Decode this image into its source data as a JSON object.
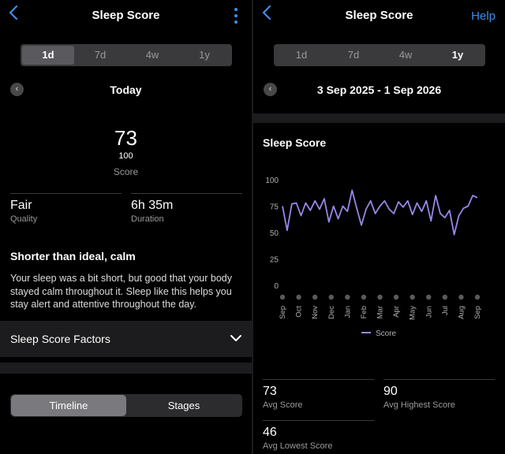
{
  "left": {
    "header": {
      "title": "Sleep Score"
    },
    "ranges": [
      "1d",
      "7d",
      "4w",
      "1y"
    ],
    "active_range": "1d",
    "date_label": "Today",
    "score": {
      "value": "73",
      "max": "100",
      "label": "Score"
    },
    "quality": {
      "value": "Fair",
      "label": "Quality"
    },
    "duration": {
      "value": "6h 35m",
      "label": "Duration"
    },
    "headline": "Shorter than ideal, calm",
    "body": "Your sleep was a bit short, but good that your body stayed calm throughout it. Sleep like this helps you stay alert and attentive throughout the day.",
    "factors_label": "Sleep Score Factors",
    "tabs": [
      "Timeline",
      "Stages"
    ],
    "active_tab": "Timeline"
  },
  "right": {
    "header": {
      "title": "Sleep Score",
      "help": "Help"
    },
    "ranges": [
      "1d",
      "7d",
      "4w",
      "1y"
    ],
    "active_range": "1y",
    "date_label": "3 Sep 2025 - 1 Sep 2026",
    "chart_title": "Sleep Score",
    "stats": {
      "avg": {
        "value": "73",
        "label": "Avg Score"
      },
      "highest": {
        "value": "90",
        "label": "Avg Highest Score"
      },
      "lowest": {
        "value": "46",
        "label": "Avg Lowest Score"
      }
    }
  },
  "colors": {
    "accent": "#3d8ef0",
    "line": "#9b86e8"
  },
  "chart_data": {
    "type": "line",
    "title": "Sleep Score",
    "xlabel": "",
    "ylabel": "",
    "categories": [
      "Sep",
      "Oct",
      "Nov",
      "Dec",
      "Jan",
      "Feb",
      "Mar",
      "Apr",
      "May",
      "Jun",
      "Jul",
      "Aug",
      "Sep"
    ],
    "y_ticks": [
      0,
      25,
      50,
      75,
      100
    ],
    "ylim": [
      0,
      100
    ],
    "grid": false,
    "legend": "bottom-center",
    "series": [
      {
        "name": "Score",
        "values": [
          75,
          52,
          77,
          78,
          66,
          78,
          71,
          80,
          72,
          82,
          60,
          75,
          63,
          75,
          70,
          90,
          73,
          57,
          72,
          80,
          68,
          75,
          80,
          72,
          68,
          79,
          74,
          80,
          67,
          78,
          70,
          80,
          61,
          85,
          68,
          64,
          71,
          48,
          66,
          73,
          75,
          85,
          83
        ]
      }
    ]
  }
}
